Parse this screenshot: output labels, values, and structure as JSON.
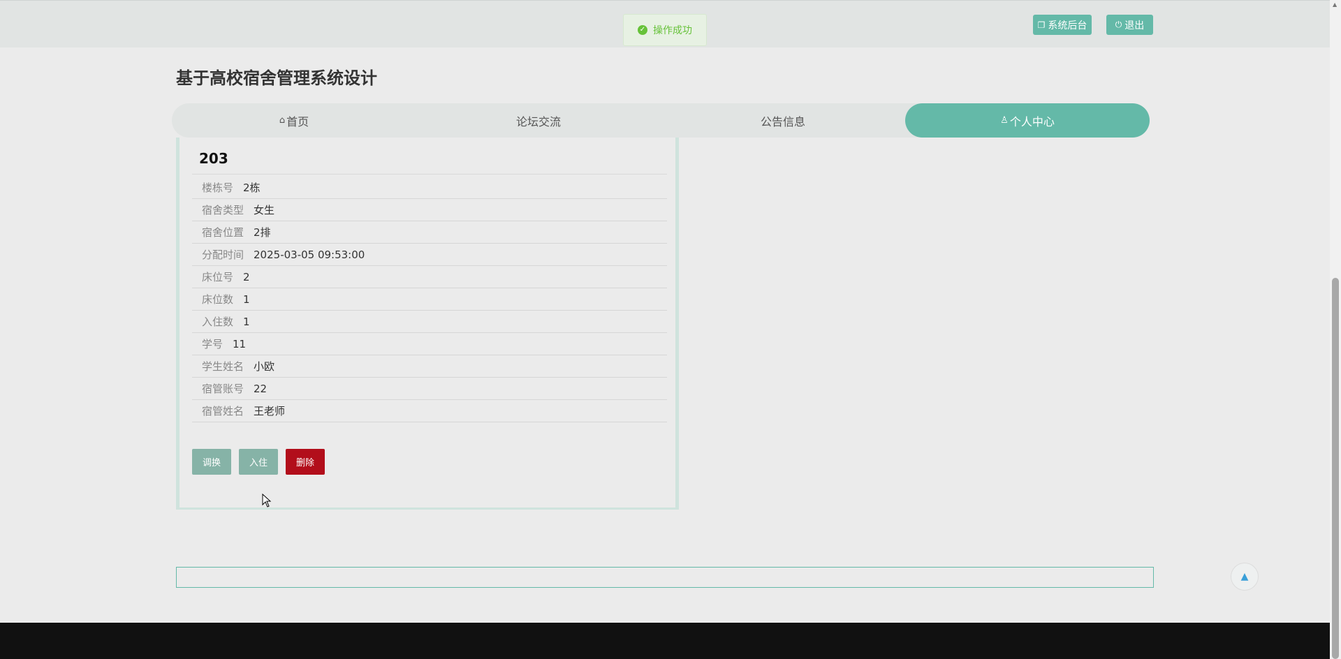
{
  "toast": {
    "text": "操作成功"
  },
  "header": {
    "admin_label": "系统后台",
    "logout_label": "退出"
  },
  "site": {
    "title": "基于高校宿舍管理系统设计"
  },
  "nav": {
    "items": [
      {
        "label": "首页",
        "icon": "home-icon"
      },
      {
        "label": "论坛交流"
      },
      {
        "label": "公告信息"
      },
      {
        "label": "个人中心",
        "icon": "user-icon",
        "active": true
      }
    ]
  },
  "room": {
    "title": "203",
    "fields": [
      {
        "label": "楼栋号",
        "value": "2栋"
      },
      {
        "label": "宿舍类型",
        "value": "女生"
      },
      {
        "label": "宿舍位置",
        "value": "2排"
      },
      {
        "label": "分配时间",
        "value": "2025-03-05 09:53:00"
      },
      {
        "label": "床位号",
        "value": "2"
      },
      {
        "label": "床位数",
        "value": "1"
      },
      {
        "label": "入住数",
        "value": "1"
      },
      {
        "label": "学号",
        "value": "11"
      },
      {
        "label": "学生姓名",
        "value": "小欧"
      },
      {
        "label": "宿管账号",
        "value": "22"
      },
      {
        "label": "宿管姓名",
        "value": "王老师"
      }
    ]
  },
  "actions": {
    "swap": "调换",
    "checkin": "入住",
    "delete": "删除"
  },
  "colors": {
    "accent": "#64b9a8",
    "danger": "#b20e1b",
    "success": "#67c23a"
  }
}
